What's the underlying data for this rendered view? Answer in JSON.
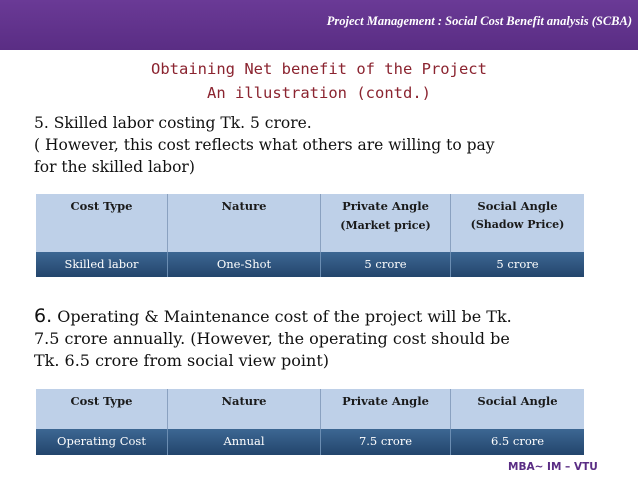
{
  "header": {
    "title": "Project Management : Social Cost Benefit analysis  (SCBA)"
  },
  "heading": {
    "line1": "Obtaining Net benefit of the Project",
    "line2": "An illustration (contd.)"
  },
  "para1": {
    "line1": "5. Skilled labor costing Tk. 5 crore.",
    "line2": "( However, this cost reflects what others are willing to pay",
    "line3": "for the skilled labor)"
  },
  "table1": {
    "headers": [
      "Cost Type",
      "Nature",
      "Private Angle",
      "Social Angle"
    ],
    "header_sub": [
      "",
      "",
      "(Market price)",
      "(Shadow Price)"
    ],
    "row": [
      "Skilled labor",
      "One-Shot",
      "5 crore",
      "5 crore"
    ]
  },
  "para2": {
    "number": "6.",
    "line1": " Operating & Maintenance cost of the project will be Tk.",
    "line2": "7.5 crore annually. (However, the operating cost should be",
    "line3": "Tk. 6.5 crore from social view point)"
  },
  "table2": {
    "headers": [
      "Cost Type",
      "Nature",
      "Private Angle",
      "Social Angle"
    ],
    "row": [
      "Operating Cost",
      "Annual",
      "7.5 crore",
      "6.5 crore"
    ]
  },
  "footer": {
    "text": "MBA~ IM – VTU"
  }
}
